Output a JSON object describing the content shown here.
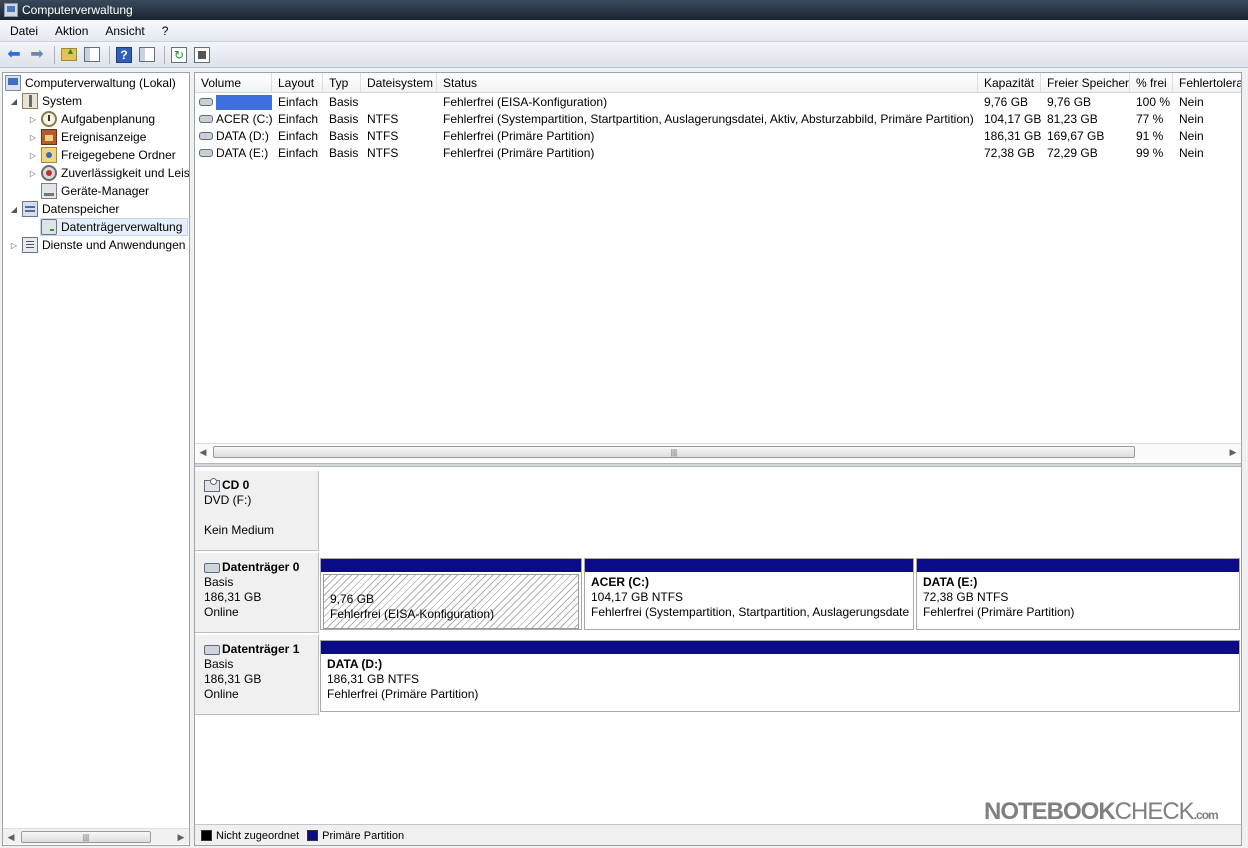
{
  "window": {
    "title": "Computerverwaltung"
  },
  "menu": [
    "Datei",
    "Aktion",
    "Ansicht",
    "?"
  ],
  "toolbar": {
    "icons": [
      "back-arrow-icon",
      "forward-arrow-icon",
      "folder-up-icon",
      "show-hide-console-tree-icon",
      "help-icon",
      "show-hide-action-pane-icon",
      "refresh-icon",
      "export-list-icon"
    ]
  },
  "tree": {
    "root": "Computerverwaltung (Lokal)",
    "system": "System",
    "aufgaben": "Aufgabenplanung",
    "ereignis": "Ereignisanzeige",
    "freigaben": "Freigegebene Ordner",
    "zuverl": "Zuverlässigkeit und Leis",
    "geraete": "Geräte-Manager",
    "datenspeicher": "Datenspeicher",
    "datentraeger": "Datenträgerverwaltung",
    "dienste": "Dienste und Anwendungen"
  },
  "volumes": {
    "columns": [
      "Volume",
      "Layout",
      "Typ",
      "Dateisystem",
      "Status",
      "Kapazität",
      "Freier Speicher",
      "% frei",
      "Fehlertolera"
    ],
    "rows": [
      {
        "volume": "",
        "layout": "Einfach",
        "typ": "Basis",
        "fs": "",
        "status": "Fehlerfrei (EISA-Konfiguration)",
        "kap": "9,76 GB",
        "frei": "9,76 GB",
        "pct": "100 %",
        "ft": "Nein"
      },
      {
        "volume": "ACER (C:)",
        "layout": "Einfach",
        "typ": "Basis",
        "fs": "NTFS",
        "status": "Fehlerfrei (Systempartition, Startpartition, Auslagerungsdatei, Aktiv, Absturzabbild, Primäre Partition)",
        "kap": "104,17 GB",
        "frei": "81,23 GB",
        "pct": "77 %",
        "ft": "Nein"
      },
      {
        "volume": "DATA (D:)",
        "layout": "Einfach",
        "typ": "Basis",
        "fs": "NTFS",
        "status": "Fehlerfrei (Primäre Partition)",
        "kap": "186,31 GB",
        "frei": "169,67 GB",
        "pct": "91 %",
        "ft": "Nein"
      },
      {
        "volume": "DATA (E:)",
        "layout": "Einfach",
        "typ": "Basis",
        "fs": "NTFS",
        "status": "Fehlerfrei (Primäre Partition)",
        "kap": "72,38 GB",
        "frei": "72,29 GB",
        "pct": "99 %",
        "ft": "Nein"
      }
    ]
  },
  "disks": {
    "cd0": {
      "name": "CD 0",
      "type": "DVD (F:)",
      "status": "Kein Medium"
    },
    "disk0": {
      "name": "Datenträger 0",
      "type": "Basis",
      "size": "186,31 GB",
      "status": "Online",
      "p1": {
        "size": "9,76 GB",
        "status": "Fehlerfrei (EISA-Konfiguration)"
      },
      "p2": {
        "title": "ACER  (C:)",
        "size": "104,17 GB NTFS",
        "status": "Fehlerfrei (Systempartition, Startpartition, Auslagerungsdate"
      },
      "p3": {
        "title": "DATA  (E:)",
        "size": "72,38 GB NTFS",
        "status": "Fehlerfrei (Primäre Partition)"
      }
    },
    "disk1": {
      "name": "Datenträger 1",
      "type": "Basis",
      "size": "186,31 GB",
      "status": "Online",
      "p1": {
        "title": "DATA  (D:)",
        "size": "186,31 GB NTFS",
        "status": "Fehlerfrei (Primäre Partition)"
      }
    }
  },
  "legend": {
    "unallocated": "Nicht zugeordnet",
    "primary": "Primäre Partition",
    "unallocated_color": "#000000",
    "primary_color": "#0b0b8a"
  },
  "watermark": {
    "bold": "NOTEBOOK",
    "thin": "CHECK",
    "dom": ".com"
  }
}
